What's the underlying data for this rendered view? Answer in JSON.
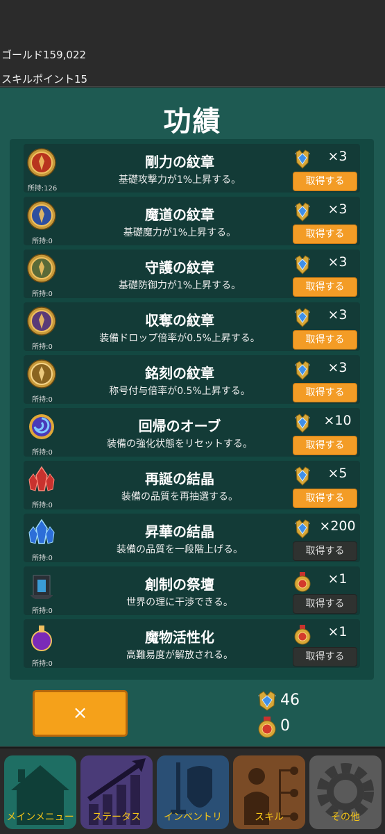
{
  "header": {
    "gold_label": "ゴールド159,022",
    "sp_label": "スキルポイント15"
  },
  "title": "功績",
  "items": [
    {
      "name": "剛力の紋章",
      "desc": "基礎攻撃力が1%上昇する。",
      "owned": "所持:126",
      "cost": "×3",
      "currency": "sapphire-medal",
      "button": "取得する",
      "enabled": true,
      "icon": "red-trident-crest-icon"
    },
    {
      "name": "魔道の紋章",
      "desc": "基礎魔力が1%上昇する。",
      "owned": "所持:0",
      "cost": "×3",
      "currency": "sapphire-medal",
      "button": "取得する",
      "enabled": true,
      "icon": "blue-book-crest-icon"
    },
    {
      "name": "守護の紋章",
      "desc": "基礎防御力が1%上昇する。",
      "owned": "所持:0",
      "cost": "×3",
      "currency": "sapphire-medal",
      "button": "取得する",
      "enabled": true,
      "icon": "green-shield-crest-icon"
    },
    {
      "name": "収奪の紋章",
      "desc": "装備ドロップ倍率が0.5%上昇する。",
      "owned": "所持:0",
      "cost": "×3",
      "currency": "sapphire-medal",
      "button": "取得する",
      "enabled": true,
      "icon": "purple-bag-crest-icon"
    },
    {
      "name": "銘刻の紋章",
      "desc": "称号付与倍率が0.5%上昇する。",
      "owned": "所持:0",
      "cost": "×3",
      "currency": "sapphire-medal",
      "button": "取得する",
      "enabled": true,
      "icon": "gold-quill-crest-icon"
    },
    {
      "name": "回帰のオーブ",
      "desc": "装備の強化状態をリセットする。",
      "owned": "所持:0",
      "cost": "×10",
      "currency": "sapphire-medal",
      "button": "取得する",
      "enabled": true,
      "icon": "swirl-orb-icon"
    },
    {
      "name": "再誕の結晶",
      "desc": "装備の品質を再抽選する。",
      "owned": "所持:0",
      "cost": "×5",
      "currency": "sapphire-medal",
      "button": "取得する",
      "enabled": true,
      "icon": "red-crystal-icon"
    },
    {
      "name": "昇華の結晶",
      "desc": "装備の品質を一段階上げる。",
      "owned": "所持:0",
      "cost": "×200",
      "currency": "sapphire-medal",
      "button": "取得する",
      "enabled": false,
      "icon": "blue-crystal-icon"
    },
    {
      "name": "創制の祭壇",
      "desc": "世界の理に干渉できる。",
      "owned": "所持:0",
      "cost": "×1",
      "currency": "ruby-medal",
      "button": "取得する",
      "enabled": false,
      "icon": "altar-icon"
    },
    {
      "name": "魔物活性化",
      "desc": "高難易度が解放される。",
      "owned": "所持:0",
      "cost": "×1",
      "currency": "ruby-medal",
      "button": "取得する",
      "enabled": false,
      "icon": "purple-potion-icon"
    }
  ],
  "close_label": "×",
  "currencies": {
    "sapphire_count": "46",
    "ruby_count": "0"
  },
  "nav": [
    {
      "label": "メインメニュー",
      "icon": "house-icon",
      "color": "#1e6e63"
    },
    {
      "label": "ステータス",
      "icon": "stats-chart-icon",
      "color": "#4a3b78"
    },
    {
      "label": "インベントリ",
      "icon": "sword-shield-icon",
      "color": "#2a4f75"
    },
    {
      "label": "スキル",
      "icon": "skill-tree-icon",
      "color": "#7a4b26"
    },
    {
      "label": "その他",
      "icon": "gear-icon",
      "color": "#5a5a5a"
    }
  ],
  "colors": {
    "panel": "#1e5a52",
    "row": "#133b37",
    "accent_button": "#f39c26",
    "disabled_button": "#2f3230",
    "nav_label": "#f5c518"
  }
}
